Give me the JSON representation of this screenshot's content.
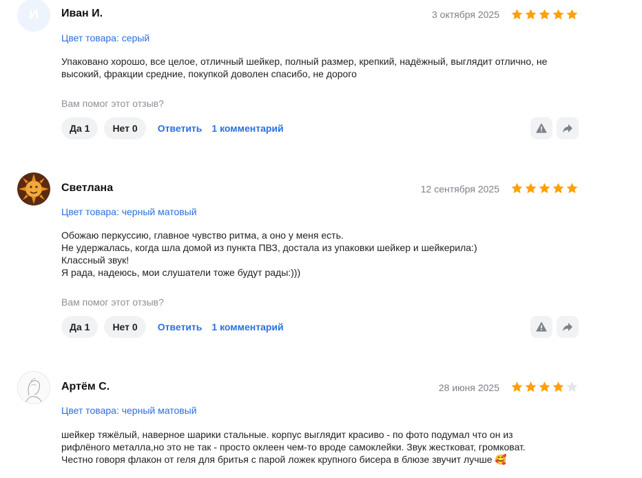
{
  "colors": {
    "link": "#2a6fe0",
    "star_filled": "#ff9f0a",
    "star_empty": "#e4e6ea",
    "pill_bg": "#f1f2f4",
    "muted": "#7a7f87"
  },
  "helpful_question": "Вам помог этот отзыв?",
  "reviews": [
    {
      "author": "Иван И.",
      "avatar_letter": "И",
      "date": "3 октября 2025",
      "rating": 5,
      "product_color": "Цвет товара: серый",
      "text_lines": [
        "Упаковано хорошо, все целое, отличный шейкер, полный размер, крепкий, надёжный, выглядит отлично, не",
        "высокий, фракции средние, покупкой доволен спасибо, не дорого"
      ],
      "yes_label": "Да 1",
      "no_label": "Нет 0",
      "reply_label": "Ответить",
      "comments_label": "1 комментарий",
      "report_icon": "warning-icon",
      "share_icon": "share-arrow-icon"
    },
    {
      "author": "Светлана",
      "avatar_icon": "sun-face-avatar",
      "date": "12 сентября 2025",
      "rating": 5,
      "product_color": "Цвет товара: черный матовый",
      "text_lines": [
        "Обожаю перкуссию, главное чувство ритма, а оно у меня есть.",
        "Не удержалась, когда шла домой из пункта ПВЗ, достала из упаковки шейкер и шейкерила:)",
        "Классный звук!",
        "Я рада, надеюсь, мои слушатели тоже будут рады:)))"
      ],
      "yes_label": "Да 1",
      "no_label": "Нет 0",
      "reply_label": "Ответить",
      "comments_label": "1 комментарий",
      "report_icon": "warning-icon",
      "share_icon": "share-arrow-icon"
    },
    {
      "author": "Артём С.",
      "avatar_icon": "sketch-portrait-avatar",
      "date": "28 июня 2025",
      "rating": 4,
      "product_color": "Цвет товара: черный матовый",
      "text_lines": [
        "шейкер тяжёлый, наверное шарики стальные. корпус выглядит красиво - по фото подумал что он из",
        "рифлёного металла,но это не так - просто оклеен чем-то вроде самоклейки. Звук жестковат, громковат.",
        "Честно говоря флакон от геля для бритья с парой ложек крупного бисера в блюзе звучит лучше 🥰"
      ]
    }
  ]
}
